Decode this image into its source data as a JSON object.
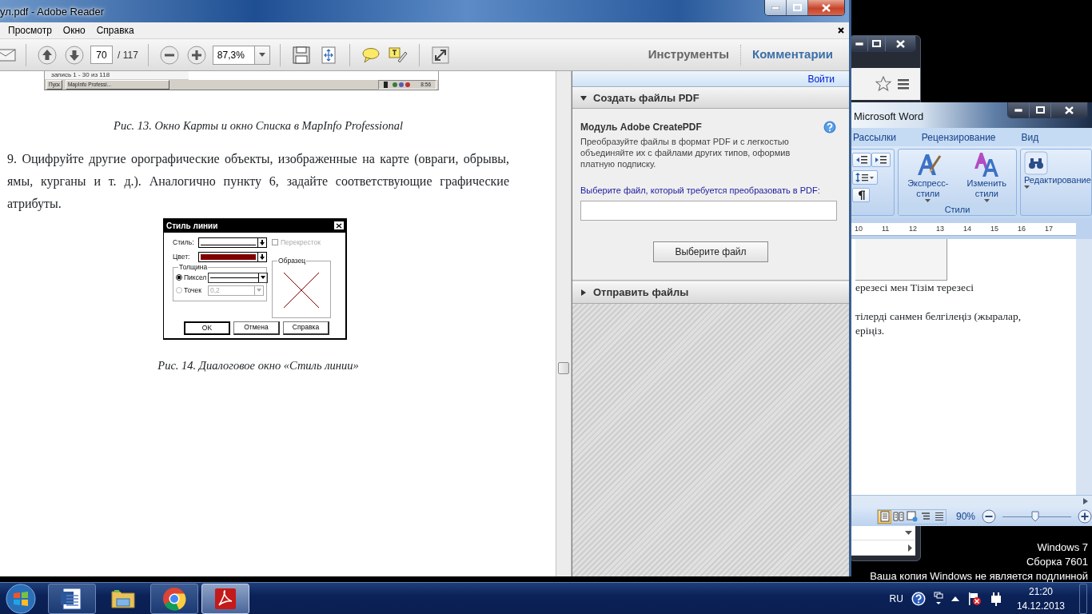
{
  "reader": {
    "title": "ул.pdf - Adobe Reader",
    "menu": [
      {
        "label": "Просмотр"
      },
      {
        "label": "Окно"
      },
      {
        "label": "Справка"
      }
    ],
    "toolbar": {
      "page": "70",
      "page_total": "/ 117",
      "zoom": "87,3%"
    },
    "modes": [
      {
        "label": "Инструменты",
        "selected": false
      },
      {
        "label": "Комментарии",
        "selected": true
      }
    ],
    "page": {
      "image_status": "запись 1 - 30 из 118",
      "image_start": "Пуск",
      "image_app": "MapInfo Professi...",
      "image_clock": "8:56",
      "caption_1": "Рис. 13. Окно Карты и окно Списка в MapInfo Professional",
      "paragraph": "9. Оцифруйте другие орографические объекты, изображенные на карте (овраги, обрывы, ямы, курганы и т. д.). Аналогично пункту 6, задайте соответствующие графические атрибуты.",
      "dialog": {
        "title": "Стиль линии",
        "style_label": "Стиль:",
        "color_label": "Цвет:",
        "color": "#800000",
        "crossing": {
          "label": "Перекресток",
          "checked": false,
          "disabled": true
        },
        "sample_label": "Образец",
        "thickness_label": "Толщина",
        "units": [
          {
            "label": "Пиксел",
            "selected": true,
            "disabled": false
          },
          {
            "label": "Точек",
            "selected": false,
            "disabled": true,
            "value": "0,2"
          }
        ],
        "buttons": [
          {
            "label": "OK",
            "default": true
          },
          {
            "label": "Отмена",
            "default": false
          },
          {
            "label": "Справка",
            "default": false
          }
        ]
      },
      "caption_2": "Рис. 14. Диалоговое окно «Стиль линии»"
    },
    "panel": {
      "sign_in": "Войти",
      "sections": [
        {
          "title": "Создать файлы PDF",
          "expanded": true,
          "module": "Модуль Adobe CreatePDF",
          "description": "Преобразуйте файлы в формат PDF и с легкостью объединяйте их с файлами других типов, оформив платную подписку.",
          "prompt": "Выберите файл, который требуется преобразовать в PDF:",
          "button": "Выберите файл"
        },
        {
          "title": "Отправить файлы",
          "expanded": false
        }
      ]
    }
  },
  "word": {
    "title": "Microsoft Word",
    "tabs": [
      {
        "label": "Рассылки"
      },
      {
        "label": "Рецензирование"
      },
      {
        "label": "Вид"
      }
    ],
    "styles": [
      {
        "label": "Экспресс-стили"
      },
      {
        "label": "Изменить стили"
      }
    ],
    "styles_group": "Стили",
    "editing": "Редактирование",
    "ruler": [
      "10",
      "11",
      "12",
      "13",
      "14",
      "15",
      "16",
      "17"
    ],
    "lines": [
      "ерезесі мен Тізім терезесі",
      "тілерді санмен белгілеңіз (жыралар,",
      "еріңіз."
    ],
    "views": [
      {
        "kind": "print",
        "selected": true
      },
      {
        "kind": "reading",
        "selected": false
      },
      {
        "kind": "web",
        "selected": false
      },
      {
        "kind": "outline",
        "selected": false
      },
      {
        "kind": "draft",
        "selected": false
      }
    ],
    "zoom": "90%",
    "zoom_slider": {
      "level": 0.47
    }
  },
  "notice": [
    "Windows 7",
    "Сборка 7601",
    "Ваша копия Windows не является подлинной"
  ],
  "taskbar": {
    "apps": [
      {
        "kind": "word",
        "running": true,
        "selected": false
      },
      {
        "kind": "explorer",
        "running": false,
        "selected": false
      },
      {
        "kind": "chrome",
        "running": true,
        "selected": false
      },
      {
        "kind": "acrobat",
        "running": true,
        "selected": true
      }
    ],
    "language": "RU",
    "time": "21:20",
    "date": "14.12.2013"
  }
}
